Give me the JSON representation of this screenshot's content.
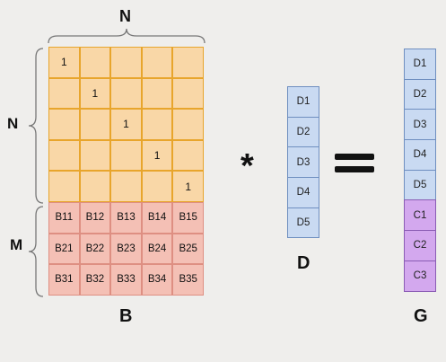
{
  "matrix_B": {
    "label": "B",
    "top_label": "N",
    "left_upper_label": "N",
    "left_lower_label": "M",
    "rows": [
      [
        "1",
        "",
        "",
        "",
        ""
      ],
      [
        "",
        "1",
        "",
        "",
        ""
      ],
      [
        "",
        "",
        "1",
        "",
        ""
      ],
      [
        "",
        "",
        "",
        "1",
        ""
      ],
      [
        "",
        "",
        "",
        "",
        "1"
      ],
      [
        "B11",
        "B12",
        "B13",
        "B14",
        "B15"
      ],
      [
        "B21",
        "B22",
        "B23",
        "B24",
        "B25"
      ],
      [
        "B31",
        "B32",
        "B33",
        "B34",
        "B35"
      ]
    ]
  },
  "multiply_symbol": "*",
  "vector_D": {
    "label": "D",
    "cells": [
      "D1",
      "D2",
      "D3",
      "D4",
      "D5"
    ]
  },
  "equals_symbol": "=",
  "vector_G": {
    "label": "G",
    "cells": [
      "D1",
      "D2",
      "D3",
      "D4",
      "D5",
      "C1",
      "C2",
      "C3"
    ]
  },
  "colors": {
    "identity_fill": "#f9d7a7",
    "identity_border": "#e8a52c",
    "b_fill": "#f4c0b5",
    "d_fill": "#c9daf2",
    "c_fill": "#d3a8ee"
  }
}
